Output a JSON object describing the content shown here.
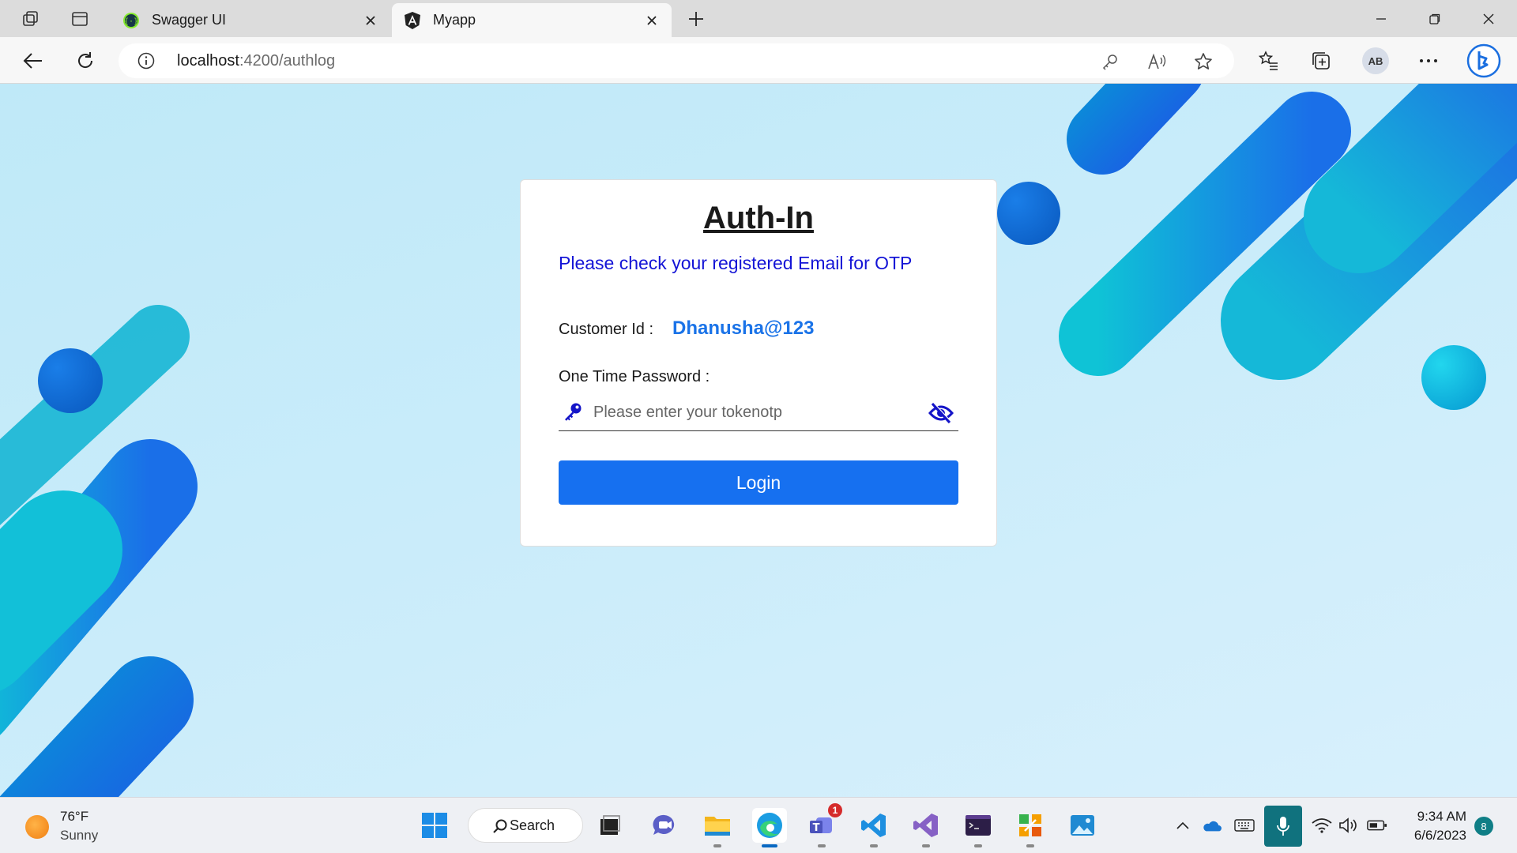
{
  "browser": {
    "tabs": [
      {
        "title": "Swagger UI",
        "active": false
      },
      {
        "title": "Myapp",
        "active": true
      }
    ],
    "url": {
      "host": "localhost",
      "path": ":4200/authlog"
    },
    "profile_initials": "AB"
  },
  "page": {
    "title": "Auth-In",
    "notice": "Please check your registered Email for OTP",
    "customer_id_label": "Customer Id :",
    "customer_id_value": "Dhanusha@123",
    "otp_label": "One Time Password :",
    "otp_placeholder": "Please enter your tokenotp",
    "login_label": "Login"
  },
  "taskbar": {
    "weather": {
      "temp": "76°F",
      "condition": "Sunny"
    },
    "search_label": "Search",
    "teams_badge": "1",
    "time": "9:34 AM",
    "date": "6/6/2023",
    "notification_count": "8"
  },
  "colors": {
    "accent": "#1670f0",
    "notice_text": "#1414d6",
    "customer_id_text": "#1a73e8",
    "page_bg": "#c9ecfa"
  }
}
